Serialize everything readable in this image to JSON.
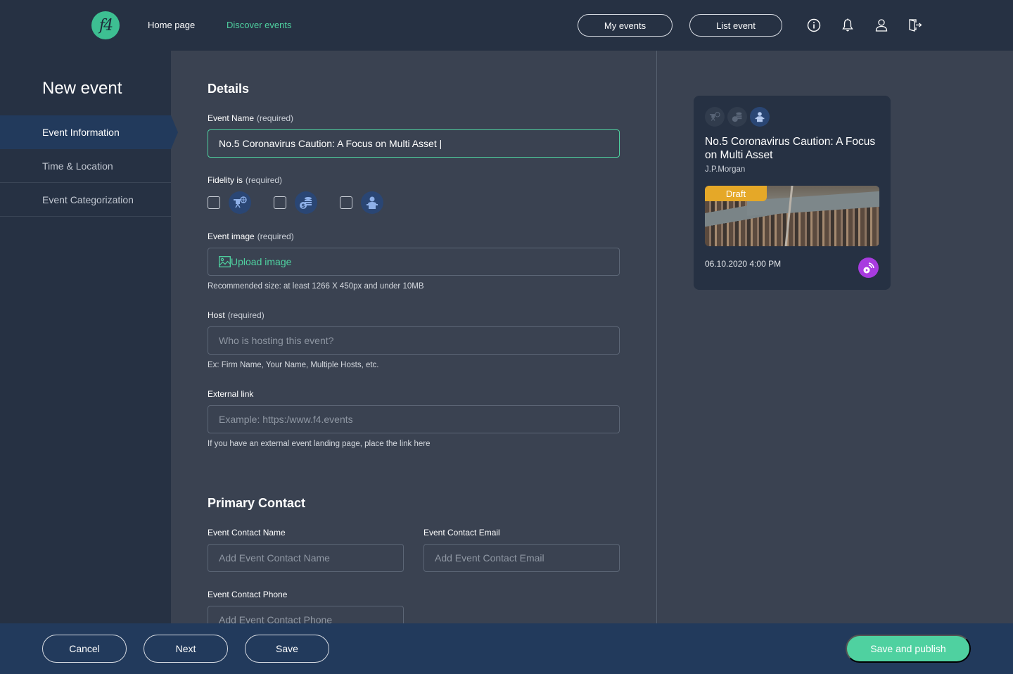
{
  "nav": {
    "logo_text": "f4",
    "links": [
      {
        "label": "Home page",
        "active": false
      },
      {
        "label": "Discover events",
        "active": true
      }
    ],
    "my_events": "My events",
    "list_event": "List event",
    "icons": [
      "info-icon",
      "bell-icon",
      "user-icon",
      "logout-icon"
    ]
  },
  "sidebar": {
    "title": "New event",
    "items": [
      {
        "label": "Event Information",
        "active": true
      },
      {
        "label": "Time & Location",
        "active": false
      },
      {
        "label": "Event Categorization",
        "active": false
      }
    ]
  },
  "details": {
    "heading": "Details",
    "event_name": {
      "label": "Event Name",
      "required": "(required)",
      "value": "No.5 Coronavirus Caution: A Focus on Multi Asset |"
    },
    "fidelity": {
      "label": "Fidelity is",
      "required": "(required)",
      "options": [
        {
          "icon": "virtual-presentation-icon",
          "checked": false
        },
        {
          "icon": "money-stack-icon",
          "checked": false
        },
        {
          "icon": "in-person-speaker-icon",
          "checked": false
        }
      ]
    },
    "event_image": {
      "label": "Event image",
      "required": "(required)",
      "upload_label": "Upload image",
      "hint": "Recommended size: at least 1266 X 450px and under 10MB"
    },
    "host": {
      "label": "Host",
      "required": "(required)",
      "placeholder": "Who is hosting this event?",
      "hint": "Ex: Firm Name, Your Name, Multiple Hosts, etc."
    },
    "external_link": {
      "label": "External link",
      "placeholder": "Example: https:/www.f4.events",
      "hint": "If you have an external event landing page, place the link here"
    }
  },
  "contact": {
    "heading": "Primary Contact",
    "name": {
      "label": "Event Contact Name",
      "placeholder": "Add Event Contact Name"
    },
    "email": {
      "label": "Event Contact Email",
      "placeholder": "Add Event Contact Email"
    },
    "phone": {
      "label": "Event Contact Phone",
      "placeholder": "Add Event Contact Phone"
    }
  },
  "preview": {
    "title": "No.5 Coronavirus Caution: A Focus on Multi Asset",
    "host": "J.P.Morgan",
    "badge": "Draft",
    "datetime": "06.10.2020 4:00 PM",
    "active_fidelity": "in-person-speaker-icon"
  },
  "footer": {
    "cancel": "Cancel",
    "next": "Next",
    "save": "Save",
    "publish": "Save and publish"
  },
  "colors": {
    "accent": "#4fd1a0",
    "draft": "#e5a828",
    "live": "#a83be0"
  }
}
